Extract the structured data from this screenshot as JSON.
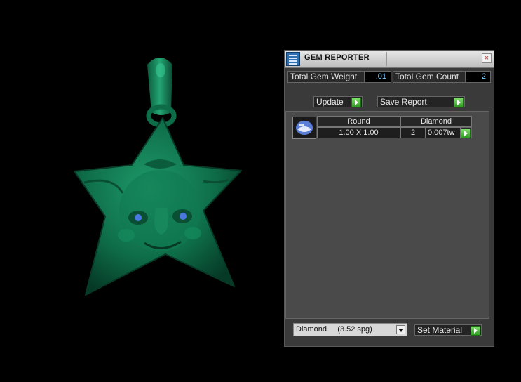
{
  "panel": {
    "title": "GEM REPORTER",
    "close_glyph": "×",
    "icon": "gem-reporter-icon"
  },
  "summary": {
    "weight_label": "Total Gem Weight",
    "weight_value": ".01",
    "count_label": "Total Gem Count",
    "count_value": "2"
  },
  "actions": {
    "update_label": "Update",
    "save_report_label": "Save Report"
  },
  "table": {
    "headers": [
      "Round",
      "Diamond"
    ],
    "rows": [
      {
        "size": "1.00 X 1.00",
        "count": "2",
        "weight": "0.007tw"
      }
    ]
  },
  "material": {
    "selected": "Diamond     (3.52 spg)",
    "set_label": "Set Material"
  },
  "colors": {
    "model": "#0f7a52",
    "accent_go": "#3cb82b",
    "value_text": "#7fd0ff"
  }
}
